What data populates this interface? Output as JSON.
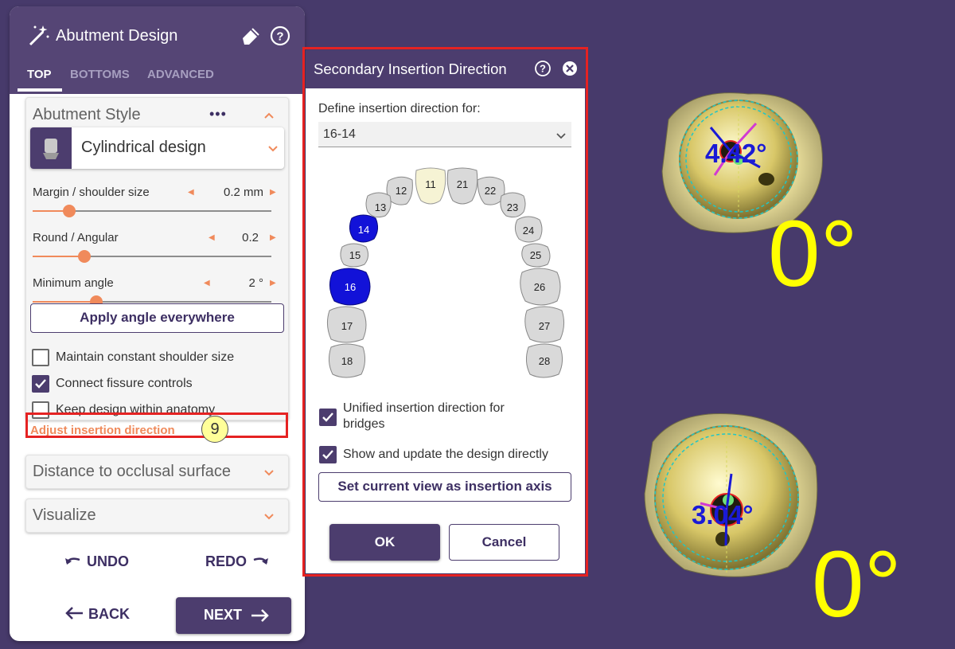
{
  "panel": {
    "title": "Abutment Design",
    "tabs": [
      "TOP",
      "BOTTOMS",
      "ADVANCED"
    ],
    "style_section": {
      "title": "Abutment Style",
      "more": "•••",
      "design_select": "Cylindrical design",
      "params": [
        {
          "label": "Margin / shoulder size",
          "value": "0.2 mm",
          "slider_fraction": 0.16
        },
        {
          "label": "Round / Angular",
          "value": "0.2",
          "slider_fraction": 0.22
        },
        {
          "label": "Minimum angle",
          "value": "2 °",
          "slider_fraction": 0.27
        }
      ],
      "apply_button": "Apply angle everywhere",
      "checkboxes": [
        {
          "label": "Maintain constant shoulder size",
          "checked": false
        },
        {
          "label": "Connect fissure controls",
          "checked": true
        },
        {
          "label": "Keep design within anatomy",
          "checked": false
        }
      ],
      "adjust_link": "Adjust insertion direction",
      "step_badge": "9"
    },
    "distance_section": "Distance to occlusal surface",
    "visualize_section": "Visualize",
    "undo": "UNDO",
    "redo": "REDO",
    "back": "BACK",
    "next": "NEXT"
  },
  "dialog": {
    "title": "Secondary Insertion Direction",
    "define_label": "Define insertion direction for:",
    "select_value": "16-14",
    "teeth": {
      "upper_right": [
        "11",
        "12",
        "13",
        "14",
        "15",
        "16",
        "17",
        "18"
      ],
      "upper_left": [
        "21",
        "22",
        "23",
        "24",
        "25",
        "26",
        "27",
        "28"
      ],
      "selected": [
        "14",
        "16"
      ],
      "highlighted": [
        "11"
      ]
    },
    "checkbox_unified": "Unified insertion direction for bridges",
    "checkbox_show": "Show and update the design directly",
    "set_view_button": "Set current view as insertion axis",
    "ok": "OK",
    "cancel": "Cancel"
  },
  "view3d": {
    "top_angle_small": "4.42°",
    "top_angle_big": "0°",
    "bottom_angle_small": "3.04°",
    "bottom_angle_big": "0°"
  },
  "colors": {
    "background": "#473a6b",
    "primary": "#4c3d6e",
    "accent": "#f08a5b",
    "highlight": "#e52222",
    "selected_tooth": "#1212d8",
    "angle_text": "#ffff00"
  }
}
